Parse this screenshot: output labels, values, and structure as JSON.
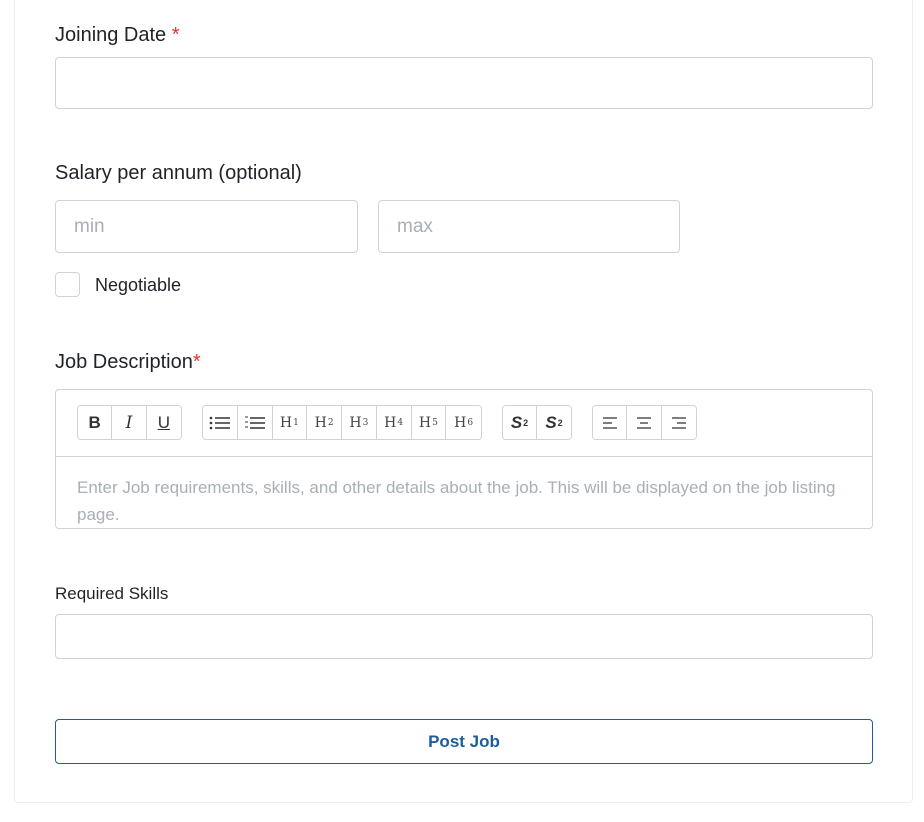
{
  "joining_date": {
    "label": "Joining Date",
    "required_mark": "*",
    "value": ""
  },
  "salary": {
    "label": "Salary per annum (optional)",
    "min_placeholder": "min",
    "max_placeholder": "max",
    "negotiable_label": "Negotiable",
    "negotiable_checked": false
  },
  "job_description": {
    "label": "Job Description",
    "required_mark": "*",
    "toolbar": {
      "bold": "B",
      "italic": "I",
      "underline": "U",
      "headings": [
        "H",
        "H",
        "H",
        "H",
        "H",
        "H"
      ],
      "heading_levels": [
        "1",
        "2",
        "3",
        "4",
        "5",
        "6"
      ],
      "superscript_base": "S",
      "superscript_mark": "2",
      "subscript_base": "S",
      "subscript_mark": "2"
    },
    "placeholder": "Enter Job requirements, skills, and other details about the job. This will be displayed on the job listing page."
  },
  "required_skills": {
    "label": "Required Skills",
    "value": ""
  },
  "submit": {
    "label": "Post Job"
  }
}
